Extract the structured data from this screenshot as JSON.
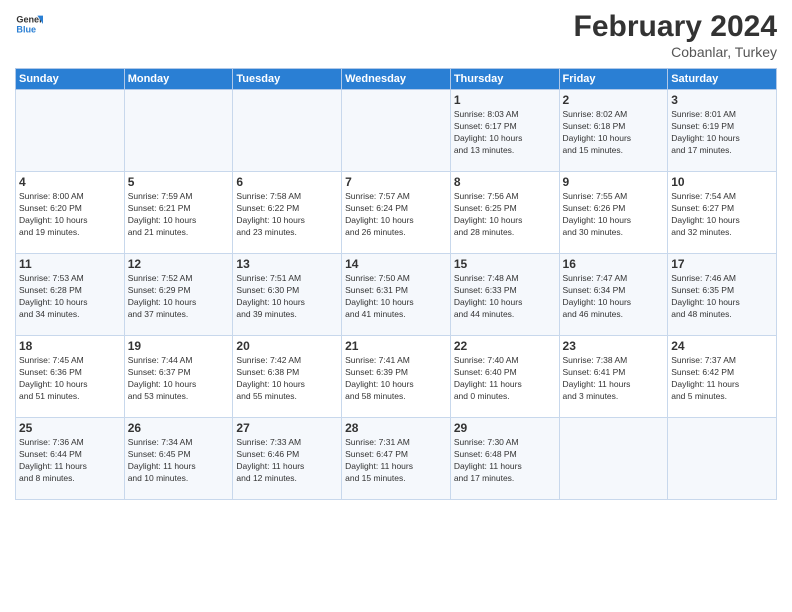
{
  "logo": {
    "line1": "General",
    "line2": "Blue"
  },
  "title": "February 2024",
  "subtitle": "Cobanlar, Turkey",
  "days_of_week": [
    "Sunday",
    "Monday",
    "Tuesday",
    "Wednesday",
    "Thursday",
    "Friday",
    "Saturday"
  ],
  "weeks": [
    [
      {
        "day": "",
        "info": ""
      },
      {
        "day": "",
        "info": ""
      },
      {
        "day": "",
        "info": ""
      },
      {
        "day": "",
        "info": ""
      },
      {
        "day": "1",
        "info": "Sunrise: 8:03 AM\nSunset: 6:17 PM\nDaylight: 10 hours\nand 13 minutes."
      },
      {
        "day": "2",
        "info": "Sunrise: 8:02 AM\nSunset: 6:18 PM\nDaylight: 10 hours\nand 15 minutes."
      },
      {
        "day": "3",
        "info": "Sunrise: 8:01 AM\nSunset: 6:19 PM\nDaylight: 10 hours\nand 17 minutes."
      }
    ],
    [
      {
        "day": "4",
        "info": "Sunrise: 8:00 AM\nSunset: 6:20 PM\nDaylight: 10 hours\nand 19 minutes."
      },
      {
        "day": "5",
        "info": "Sunrise: 7:59 AM\nSunset: 6:21 PM\nDaylight: 10 hours\nand 21 minutes."
      },
      {
        "day": "6",
        "info": "Sunrise: 7:58 AM\nSunset: 6:22 PM\nDaylight: 10 hours\nand 23 minutes."
      },
      {
        "day": "7",
        "info": "Sunrise: 7:57 AM\nSunset: 6:24 PM\nDaylight: 10 hours\nand 26 minutes."
      },
      {
        "day": "8",
        "info": "Sunrise: 7:56 AM\nSunset: 6:25 PM\nDaylight: 10 hours\nand 28 minutes."
      },
      {
        "day": "9",
        "info": "Sunrise: 7:55 AM\nSunset: 6:26 PM\nDaylight: 10 hours\nand 30 minutes."
      },
      {
        "day": "10",
        "info": "Sunrise: 7:54 AM\nSunset: 6:27 PM\nDaylight: 10 hours\nand 32 minutes."
      }
    ],
    [
      {
        "day": "11",
        "info": "Sunrise: 7:53 AM\nSunset: 6:28 PM\nDaylight: 10 hours\nand 34 minutes."
      },
      {
        "day": "12",
        "info": "Sunrise: 7:52 AM\nSunset: 6:29 PM\nDaylight: 10 hours\nand 37 minutes."
      },
      {
        "day": "13",
        "info": "Sunrise: 7:51 AM\nSunset: 6:30 PM\nDaylight: 10 hours\nand 39 minutes."
      },
      {
        "day": "14",
        "info": "Sunrise: 7:50 AM\nSunset: 6:31 PM\nDaylight: 10 hours\nand 41 minutes."
      },
      {
        "day": "15",
        "info": "Sunrise: 7:48 AM\nSunset: 6:33 PM\nDaylight: 10 hours\nand 44 minutes."
      },
      {
        "day": "16",
        "info": "Sunrise: 7:47 AM\nSunset: 6:34 PM\nDaylight: 10 hours\nand 46 minutes."
      },
      {
        "day": "17",
        "info": "Sunrise: 7:46 AM\nSunset: 6:35 PM\nDaylight: 10 hours\nand 48 minutes."
      }
    ],
    [
      {
        "day": "18",
        "info": "Sunrise: 7:45 AM\nSunset: 6:36 PM\nDaylight: 10 hours\nand 51 minutes."
      },
      {
        "day": "19",
        "info": "Sunrise: 7:44 AM\nSunset: 6:37 PM\nDaylight: 10 hours\nand 53 minutes."
      },
      {
        "day": "20",
        "info": "Sunrise: 7:42 AM\nSunset: 6:38 PM\nDaylight: 10 hours\nand 55 minutes."
      },
      {
        "day": "21",
        "info": "Sunrise: 7:41 AM\nSunset: 6:39 PM\nDaylight: 10 hours\nand 58 minutes."
      },
      {
        "day": "22",
        "info": "Sunrise: 7:40 AM\nSunset: 6:40 PM\nDaylight: 11 hours\nand 0 minutes."
      },
      {
        "day": "23",
        "info": "Sunrise: 7:38 AM\nSunset: 6:41 PM\nDaylight: 11 hours\nand 3 minutes."
      },
      {
        "day": "24",
        "info": "Sunrise: 7:37 AM\nSunset: 6:42 PM\nDaylight: 11 hours\nand 5 minutes."
      }
    ],
    [
      {
        "day": "25",
        "info": "Sunrise: 7:36 AM\nSunset: 6:44 PM\nDaylight: 11 hours\nand 8 minutes."
      },
      {
        "day": "26",
        "info": "Sunrise: 7:34 AM\nSunset: 6:45 PM\nDaylight: 11 hours\nand 10 minutes."
      },
      {
        "day": "27",
        "info": "Sunrise: 7:33 AM\nSunset: 6:46 PM\nDaylight: 11 hours\nand 12 minutes."
      },
      {
        "day": "28",
        "info": "Sunrise: 7:31 AM\nSunset: 6:47 PM\nDaylight: 11 hours\nand 15 minutes."
      },
      {
        "day": "29",
        "info": "Sunrise: 7:30 AM\nSunset: 6:48 PM\nDaylight: 11 hours\nand 17 minutes."
      },
      {
        "day": "",
        "info": ""
      },
      {
        "day": "",
        "info": ""
      }
    ]
  ]
}
